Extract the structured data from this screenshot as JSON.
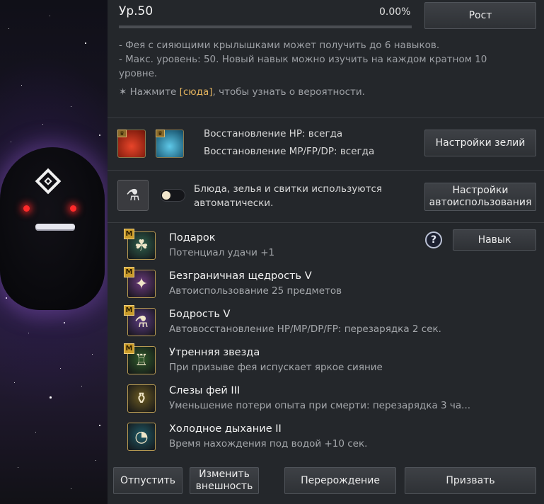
{
  "header": {
    "level": "Ур.50",
    "progress_text": "0.00%",
    "progress": 0.0,
    "grow_button": "Рост"
  },
  "info": {
    "line1": "- Фея с сияющими крылышками может получить до 6 навыков.",
    "line2": "- Макс. уровень: 50. Новый навык можно изучить на каждом кратном 10",
    "line3": "уровне.",
    "prob_prefix": "✶ Нажмите ",
    "prob_link": "[сюда]",
    "prob_suffix": ", чтобы узнать о вероятности."
  },
  "potions": {
    "hp_text": "Восстановление HP: всегда",
    "mp_text": "Восстановление MP/FP/DP: всегда",
    "settings_button": "Настройки зелий"
  },
  "auto_use": {
    "text_line1": "Блюда, зелья и свитки используются",
    "text_line2": "автоматически.",
    "toggle_on": false,
    "settings_button_line1": "Настройки",
    "settings_button_line2": "автоиспользования"
  },
  "skills_header": {
    "help_icon_glyph": "?",
    "skill_button": "Навык"
  },
  "skills": [
    {
      "name": "Подарок",
      "desc": "Потенциал удачи +1",
      "badge": "M",
      "icon": "clover-icon",
      "glyph": "☘",
      "color": "#2f5f4c"
    },
    {
      "name": "Безграничная щедрость V",
      "desc": "Автоиспользование 25 предметов",
      "badge": "M",
      "icon": "fairy-wing-icon",
      "glyph": "✦",
      "color": "#6a3a7c"
    },
    {
      "name": "Бодрость V",
      "desc": "Автовосстановление HP/MP/DP/FP: перезарядка 2 сек.",
      "badge": "M",
      "icon": "potion-plus-icon",
      "glyph": "⚗",
      "color": "#5a3a7e"
    },
    {
      "name": "Утренняя звезда",
      "desc": "При призыве фея испускает яркое сияние",
      "badge": "M",
      "icon": "lantern-icon",
      "glyph": "♖",
      "color": "#2f5a2a"
    },
    {
      "name": "Слезы фей III",
      "desc": "Уменьшение потери опыта при смерти: перезарядка 3 ча...",
      "badge": "",
      "icon": "winged-vase-icon",
      "glyph": "⚱",
      "color": "#6a5a22"
    },
    {
      "name": "Холодное дыхание II",
      "desc": "Время нахождения под водой +10 сек.",
      "badge": "",
      "icon": "bubbles-clock-icon",
      "glyph": "◔",
      "color": "#1f5a66"
    }
  ],
  "footer": {
    "release_button": "Отпустить",
    "change_look_line1": "Изменить",
    "change_look_line2": "внешность",
    "rebirth_button": "Перерождение",
    "summon_button": "Призвать"
  }
}
